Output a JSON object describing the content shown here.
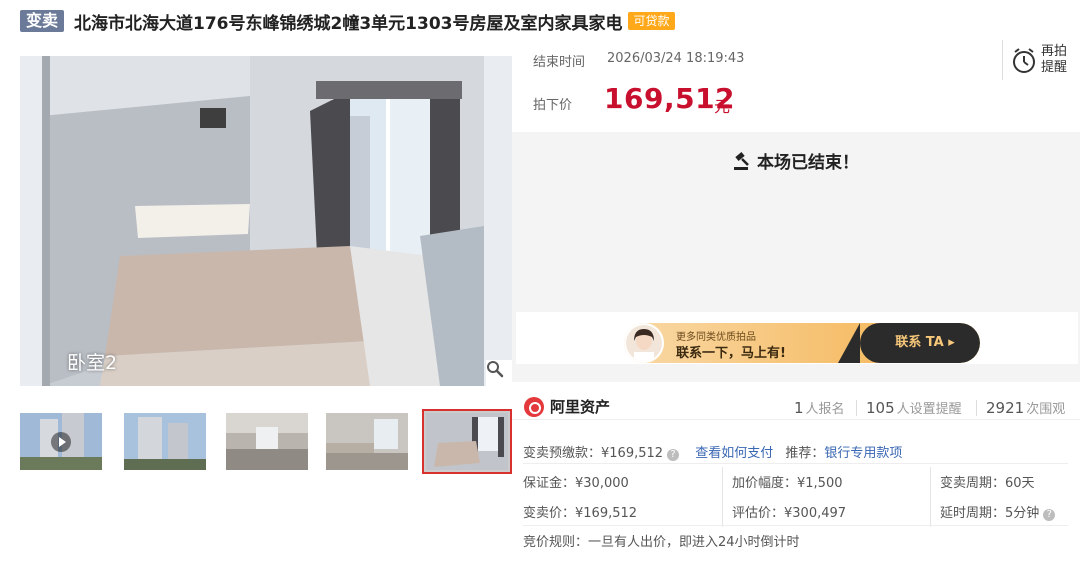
{
  "header": {
    "type_badge": "变卖",
    "title": "北海市北海大道176号东峰锦绣城2幢3单元1303号房屋及室内家具家电",
    "loan_badge": "可贷款"
  },
  "gallery": {
    "room_label": "卧室2",
    "thumbnails": [
      {
        "label": "thumb-1",
        "has_play": true
      },
      {
        "label": "thumb-2",
        "has_play": false
      },
      {
        "label": "thumb-3",
        "has_play": false
      },
      {
        "label": "thumb-4",
        "has_play": false
      },
      {
        "label": "thumb-5",
        "has_play": false
      }
    ],
    "active_thumbnail": 5
  },
  "auction": {
    "end_time_label": "结束时间",
    "end_time_value": "2026/03/24 18:19:43",
    "final_price_label": "拍下价",
    "final_price_value": "169,512",
    "final_price_unit": "元",
    "remind_label": "再拍提醒",
    "status_text": "本场已结束！"
  },
  "banner": {
    "subtitle": "更多同类优质拍品",
    "main": "联系一下，马上有!",
    "contact_label": "联系 TA ▸"
  },
  "stats": {
    "brand": "阿里资产",
    "signups_num": "1",
    "signups_label": "人报名",
    "reminders_num": "105",
    "reminders_label": "人设置提醒",
    "views_num": "2921",
    "views_label": "次围观"
  },
  "details": {
    "deposit_pre_label": "变卖预缴款：",
    "deposit_pre_value": "¥169,512",
    "how_to_pay": "查看如何支付",
    "recommend_label": "推荐：",
    "recommend_link": "银行专用款项",
    "margin": "保证金：¥30,000",
    "increment": "加价幅度：¥1,500",
    "sale_period": "变卖周期：60天",
    "sale_price": "变卖价：¥169,512",
    "appraisal": "评估价：¥300,497",
    "delay_period": "延时周期：5分钟",
    "bid_rule": "竞价规则：一旦有人出价，即进入24小时倒计时"
  },
  "colors": {
    "accent_red": "#c8102e",
    "badge_gray": "#6b7a99",
    "loan_orange": "#ffa81a",
    "link_blue": "#3a67b4"
  }
}
